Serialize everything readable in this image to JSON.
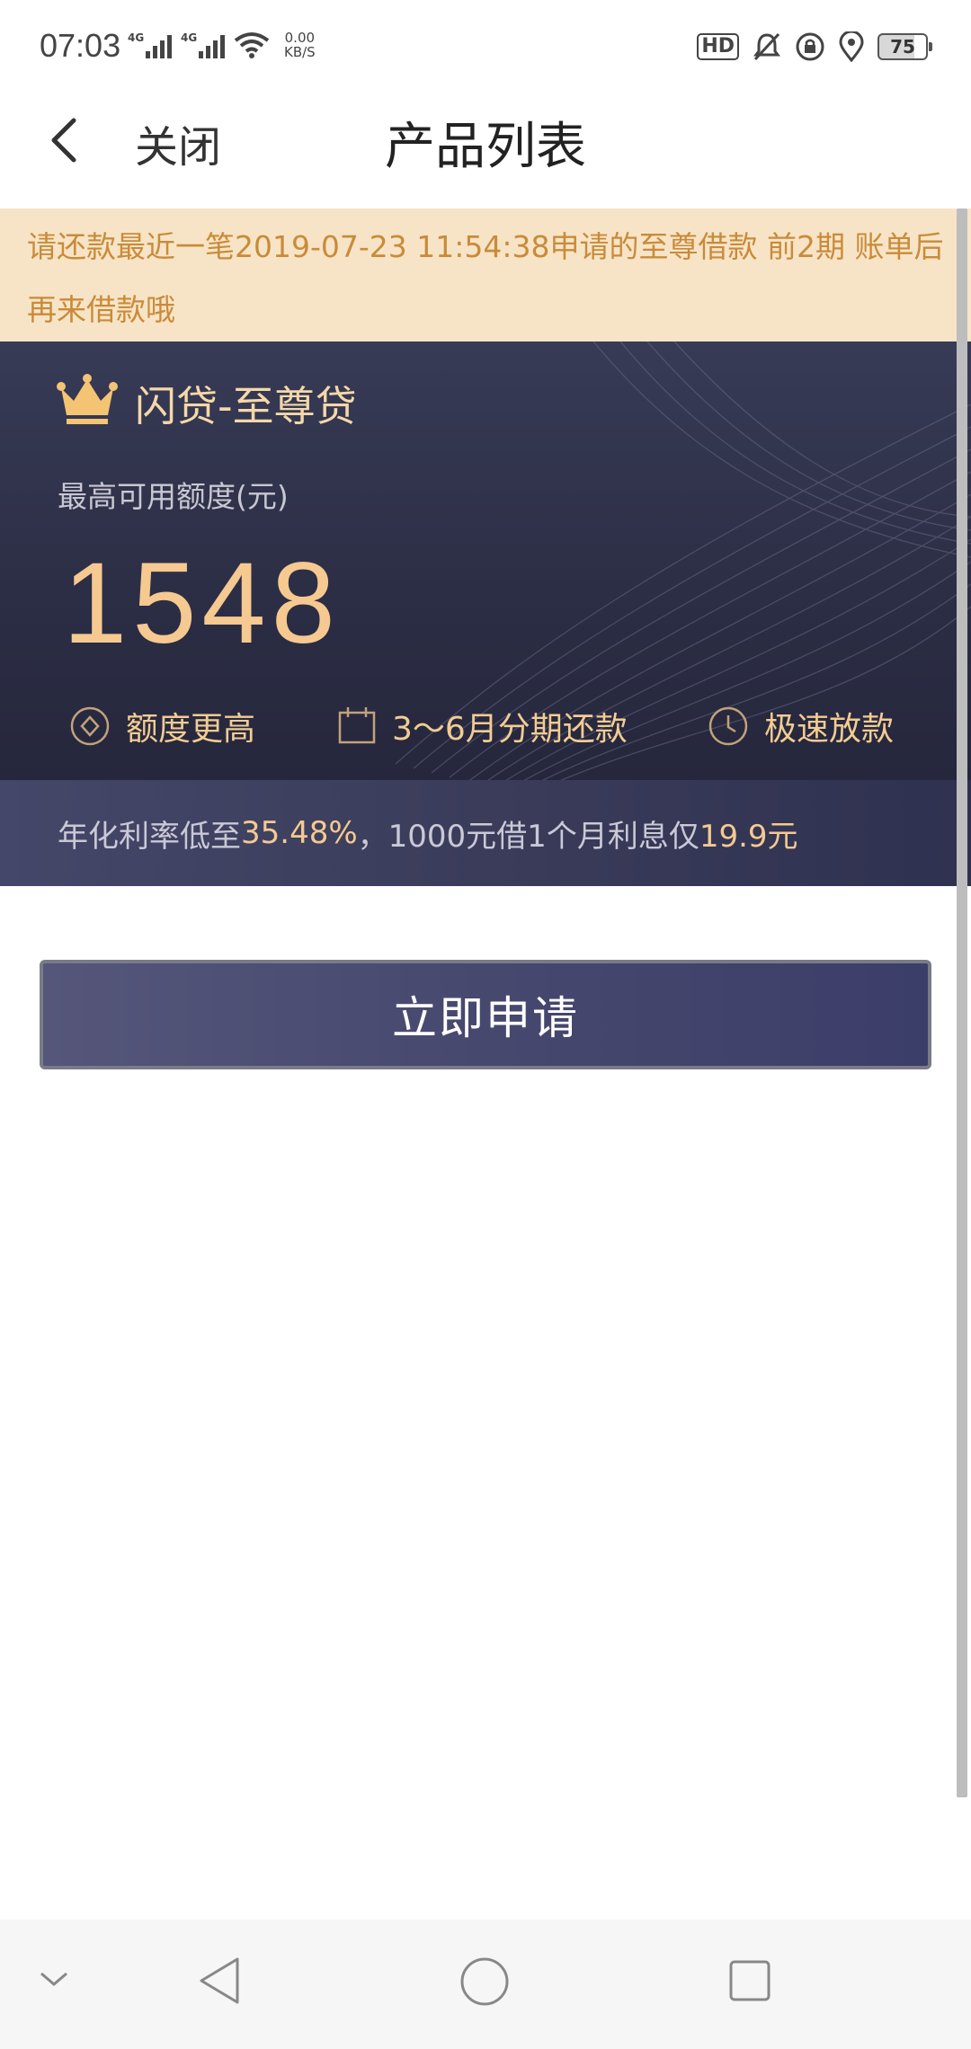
{
  "status_bar": {
    "time": "07:03",
    "sim1": "4G",
    "sim2": "4G",
    "net_speed_value": "0.00",
    "net_speed_unit": "KB/S",
    "hd": "HD",
    "battery": "75"
  },
  "header": {
    "close_label": "关闭",
    "title": "产品列表"
  },
  "notice": {
    "text": "请还款最近一笔2019-07-23 11:54:38申请的至尊借款 前2期 账单后再来借款哦"
  },
  "product": {
    "name": "闪贷-至尊贷",
    "limit_label": "最高可用额度(元)",
    "amount": "1548",
    "features": [
      "额度更高",
      "3～6月分期还款",
      "极速放款"
    ],
    "rate_prefix": "年化利率低至",
    "rate_value": "35.48%",
    "rate_middle": "，1000元借1个月利息仅",
    "interest_value": "19.9元"
  },
  "apply_button": "立即申请",
  "colors": {
    "accent_gold": "#f5c990",
    "notice_bg": "#f7e4c6",
    "notice_text": "#c98b3a",
    "card_dark": "#2b2d44"
  }
}
